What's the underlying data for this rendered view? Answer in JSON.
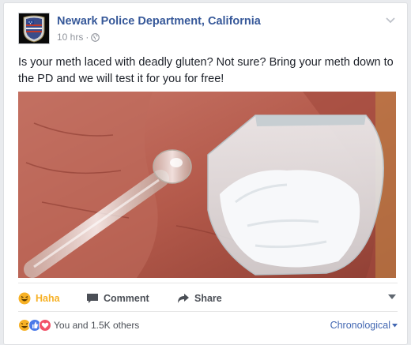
{
  "post": {
    "page_name": "Newark Police Department, California",
    "time": "10 hrs",
    "separator": "·",
    "audience_icon": "globe-icon",
    "text": "Is your meth laced with deadly gluten? Not sure? Bring your meth down to the PD and we will test it for you for free!",
    "photo_subject": "hand-holding-glass-pipe-and-baggie"
  },
  "actions": {
    "haha_label": "Haha",
    "comment_label": "Comment",
    "share_label": "Share",
    "haha_color": "#f7b125"
  },
  "reactions": {
    "icons": [
      "haha-icon",
      "like-icon",
      "love-icon"
    ],
    "summary": "You and 1.5K others",
    "sort_label": "Chronological"
  },
  "colors": {
    "link": "#365899",
    "sort": "#4267b2",
    "text": "#1d2129",
    "muted": "#90949c"
  }
}
